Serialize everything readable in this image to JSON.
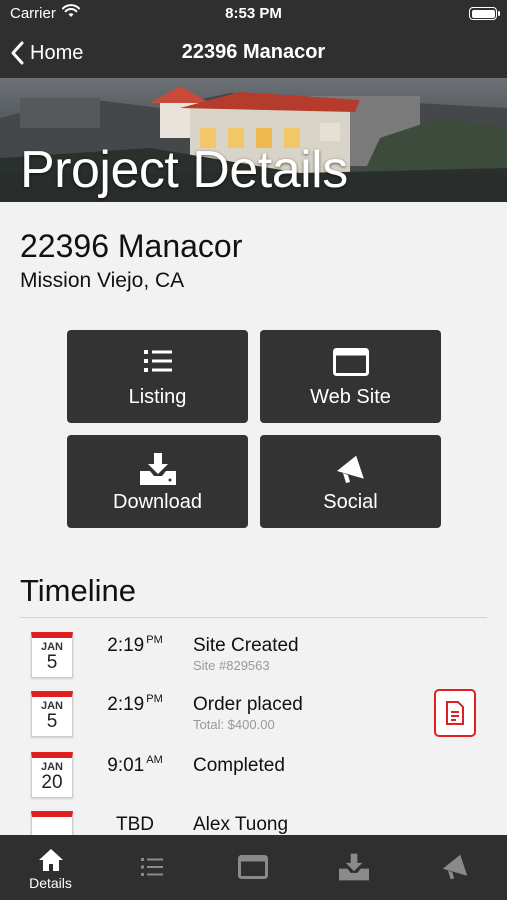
{
  "status_bar": {
    "carrier": "Carrier",
    "time": "8:53 PM"
  },
  "nav": {
    "back_label": "Home",
    "title": "22396 Manacor"
  },
  "hero": {
    "title": "Project Details"
  },
  "project": {
    "name": "22396 Manacor",
    "city": "Mission Viejo, CA"
  },
  "actions": [
    {
      "label": "Listing",
      "icon": "list-icon"
    },
    {
      "label": "Web Site",
      "icon": "browser-window-icon"
    },
    {
      "label": "Download",
      "icon": "download-icon"
    },
    {
      "label": "Social",
      "icon": "megaphone-icon"
    }
  ],
  "timeline": {
    "title": "Timeline",
    "events": [
      {
        "month": "JAN",
        "day": "5",
        "time": "2:19",
        "ampm": "PM",
        "title": "Site Created",
        "subtitle": "Site #829563"
      },
      {
        "month": "JAN",
        "day": "5",
        "time": "2:19",
        "ampm": "PM",
        "title": "Order placed",
        "subtitle": "Total: $400.00",
        "action_icon": "document-icon"
      },
      {
        "month": "JAN",
        "day": "20",
        "time": "9:01",
        "ampm": "AM",
        "title": "Completed",
        "subtitle": ""
      },
      {
        "month": "",
        "day": "",
        "time": "TBD",
        "ampm": "",
        "title": "Alex Tuong",
        "subtitle": ""
      }
    ]
  },
  "tabs": [
    {
      "label": "Details",
      "icon": "home-icon",
      "active": true
    },
    {
      "label": "",
      "icon": "list-icon"
    },
    {
      "label": "",
      "icon": "browser-window-icon"
    },
    {
      "label": "",
      "icon": "download-icon"
    },
    {
      "label": "",
      "icon": "megaphone-icon"
    }
  ],
  "colors": {
    "bar": "#2f2f2f",
    "tile": "#333333",
    "accent": "#e02020",
    "background": "#f2f2f2"
  }
}
